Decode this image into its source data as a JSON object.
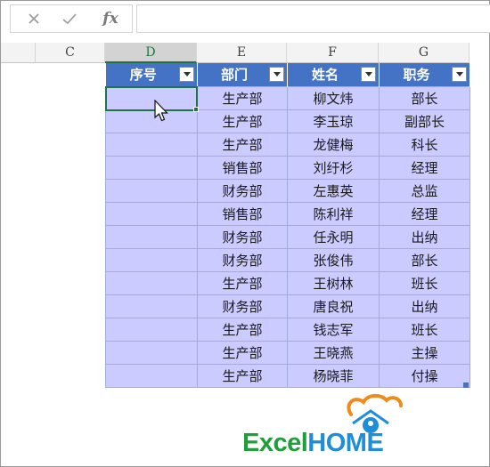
{
  "formula_bar": {
    "cancel_icon": "✕",
    "enter_icon": "✓",
    "fx_label": "fx",
    "value": ""
  },
  "columns": [
    {
      "letter": "C"
    },
    {
      "letter": "D",
      "selected": true
    },
    {
      "letter": "E"
    },
    {
      "letter": "F"
    },
    {
      "letter": "G"
    }
  ],
  "table": {
    "headers": [
      "序号",
      "部门",
      "姓名",
      "职务"
    ],
    "rows": [
      [
        "",
        "生产部",
        "柳文炜",
        "部长"
      ],
      [
        "",
        "生产部",
        "李玉琼",
        "副部长"
      ],
      [
        "",
        "生产部",
        "龙健梅",
        "科长"
      ],
      [
        "",
        "销售部",
        "刘纡杉",
        "经理"
      ],
      [
        "",
        "财务部",
        "左惠英",
        "总监"
      ],
      [
        "",
        "销售部",
        "陈利祥",
        "经理"
      ],
      [
        "",
        "财务部",
        "任永明",
        "出纳"
      ],
      [
        "",
        "财务部",
        "张俊伟",
        "部长"
      ],
      [
        "",
        "生产部",
        "王树林",
        "班长"
      ],
      [
        "",
        "财务部",
        "唐良祝",
        "出纳"
      ],
      [
        "",
        "生产部",
        "钱志军",
        "班长"
      ],
      [
        "",
        "生产部",
        "王晓燕",
        "主操"
      ],
      [
        "",
        "生产部",
        "杨晓菲",
        "付操"
      ]
    ]
  },
  "logo": {
    "part1": "Excel",
    "part2": "HOME"
  },
  "colors": {
    "header_bg": "#4472c4",
    "cell_bg": "#cccbff",
    "selection": "#217346"
  }
}
